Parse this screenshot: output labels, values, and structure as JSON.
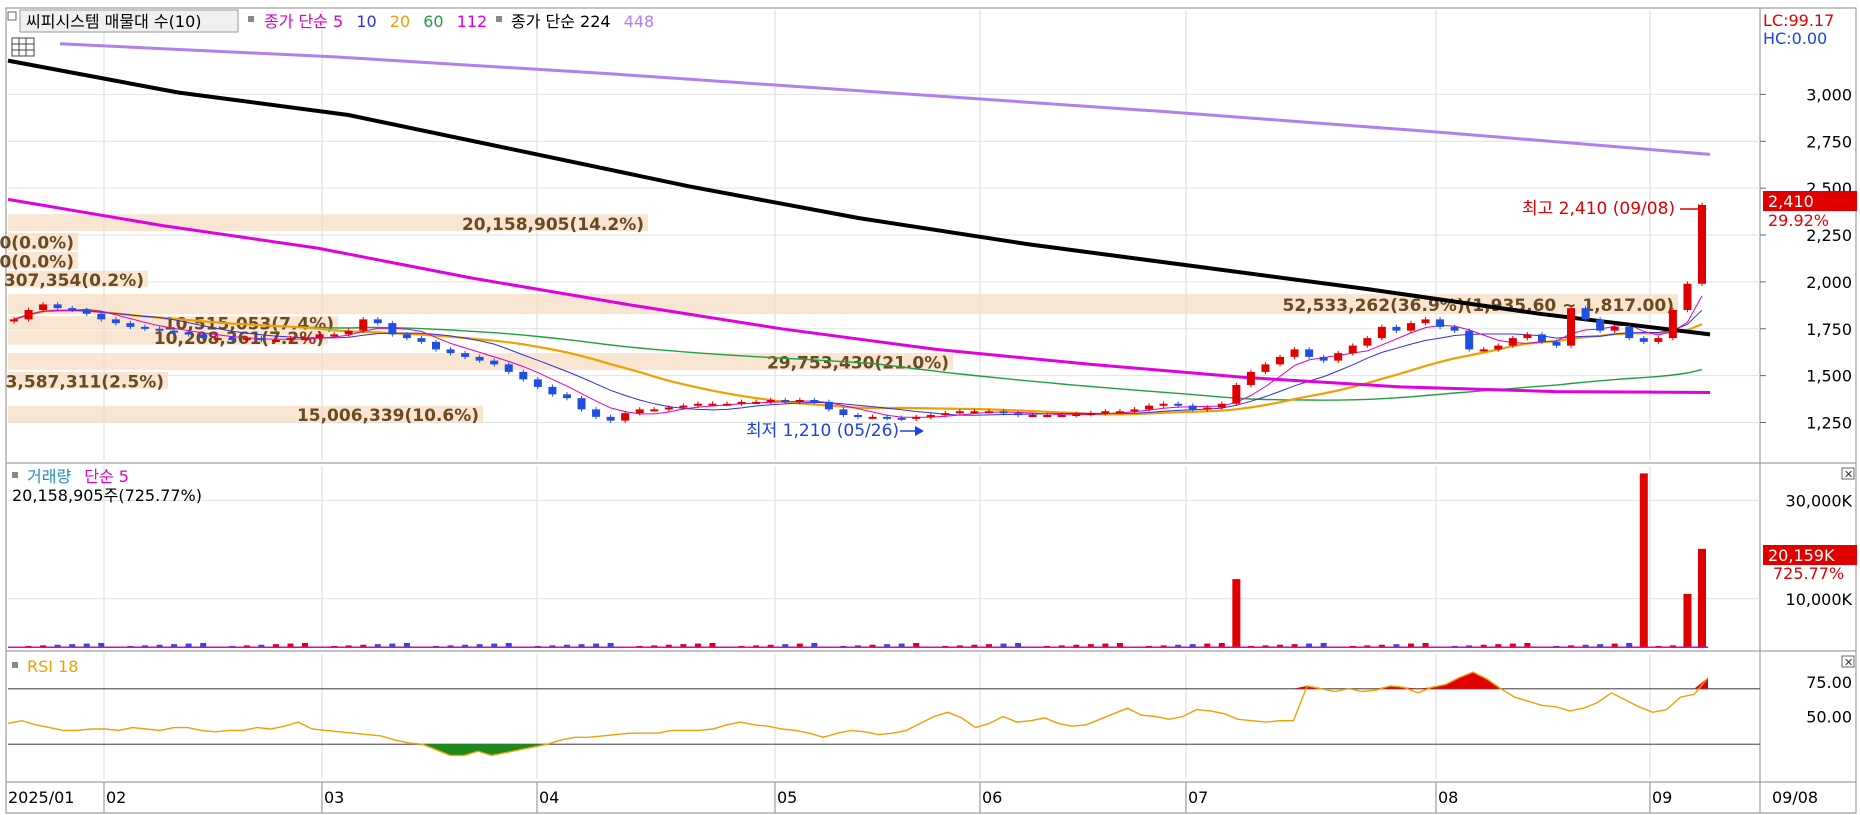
{
  "price_panel": {
    "title": "씨피시스템 매물대 수(10)",
    "legend": [
      {
        "text": "종가 단순 5",
        "color": "#e000c8"
      },
      {
        "text": "10",
        "color": "#3030e0"
      },
      {
        "text": "20",
        "color": "#f0a000"
      },
      {
        "text": "60",
        "color": "#20a040"
      },
      {
        "text": "112",
        "color": "#e000e0"
      },
      {
        "text": "종가 단순 224",
        "color": "#000000"
      },
      {
        "text": "448",
        "color": "#b080f0"
      }
    ],
    "lc_label": "LC:99.17",
    "hc_label": "HC:0.00",
    "last_price": "2,410",
    "last_change": "29.92%",
    "high_annotation": "최고 2,410 (09/08)",
    "low_annotation": "최저 1,210 (05/26)"
  },
  "volume_panel": {
    "title": "거래량",
    "ma_label": "단순 5",
    "summary": "20,158,905주(725.77%)",
    "last_volume": "20,159K",
    "last_change": "725.77%"
  },
  "rsi_panel": {
    "title": "RSI 18"
  },
  "date_axis": {
    "first_label": "2025/01",
    "last_label": "09/08"
  },
  "chart_data": [
    {
      "type": "candlestick",
      "title": "씨피시스템 매물대 수(10)",
      "y_ticks": [
        "3,000",
        "2,750",
        "2,500",
        "2,250",
        "2,000",
        "1,750",
        "1,500",
        "1,250"
      ],
      "ylim": [
        1050,
        3450
      ],
      "x_ticks": [
        "2025/01",
        "02",
        "03",
        "04",
        "05",
        "06",
        "07",
        "08",
        "09"
      ],
      "highest": {
        "value": 2410,
        "date": "09/08"
      },
      "lowest": {
        "value": 1210,
        "date": "05/26"
      },
      "close_approx": [
        1800,
        1850,
        1880,
        1860,
        1850,
        1830,
        1800,
        1780,
        1760,
        1750,
        1740,
        1730,
        1720,
        1700,
        1700,
        1690,
        1700,
        1690,
        1690,
        1700,
        1700,
        1720,
        1720,
        1740,
        1800,
        1780,
        1720,
        1700,
        1680,
        1640,
        1620,
        1600,
        1580,
        1560,
        1520,
        1480,
        1440,
        1400,
        1380,
        1320,
        1280,
        1260,
        1300,
        1320,
        1320,
        1330,
        1340,
        1350,
        1350,
        1350,
        1360,
        1360,
        1370,
        1360,
        1370,
        1360,
        1320,
        1290,
        1280,
        1280,
        1275,
        1270,
        1280,
        1290,
        1300,
        1310,
        1310,
        1310,
        1300,
        1290,
        1290,
        1290,
        1290,
        1295,
        1300,
        1310,
        1310,
        1320,
        1340,
        1350,
        1340,
        1320,
        1330,
        1350,
        1450,
        1520,
        1560,
        1600,
        1640,
        1600,
        1580,
        1620,
        1660,
        1700,
        1760,
        1740,
        1780,
        1800,
        1760,
        1740,
        1640,
        1640,
        1660,
        1700,
        1720,
        1680,
        1660,
        1860,
        1800,
        1740,
        1760,
        1700,
        1680,
        1700,
        1850,
        1990,
        2410
      ],
      "volume_profile": [
        {
          "label": "20,158,905(14.2%)",
          "price_low": 2260,
          "price_high": 2360
        },
        {
          "label": "0(0.0%)",
          "price_low": 2160,
          "price_high": 2260
        },
        {
          "label": "0(0.0%)",
          "price_low": 2060,
          "price_high": 2160
        },
        {
          "label": "307,354(0.2%)",
          "price_low": 1960,
          "price_high": 2060
        },
        {
          "label": "52,533,262(36.9%)(1,935.60 ~ 1,817.00)",
          "price_low": 1817,
          "price_high": 1935
        },
        {
          "label": "10,515,053(7.4%)",
          "price_low": 1740,
          "price_high": 1817
        },
        {
          "label": "10,208,361(7.2%)",
          "price_low": 1660,
          "price_high": 1740
        },
        {
          "label": "29,753,430(21.0%)",
          "price_low": 1520,
          "price_high": 1620
        },
        {
          "label": "3,587,311(2.5%)",
          "price_low": 1420,
          "price_high": 1520
        },
        {
          "label": "15,006,339(10.6%)",
          "price_low": 1240,
          "price_high": 1340
        }
      ],
      "series": [
        {
          "name": "종가 단순 5",
          "color": "#e000c8"
        },
        {
          "name": "10",
          "color": "#3030e0"
        },
        {
          "name": "20",
          "color": "#f0a000"
        },
        {
          "name": "60",
          "color": "#20a040"
        },
        {
          "name": "112",
          "color": "#e000e0",
          "values_approx": [
            2440,
            2300,
            2180,
            2020,
            1880,
            1750,
            1640,
            1560,
            1490,
            1440,
            1415,
            1410
          ]
        },
        {
          "name": "종가 단순 224",
          "color": "#000000",
          "values_approx": [
            3180,
            3010,
            2890,
            2700,
            2510,
            2340,
            2200,
            2080,
            1960,
            1830,
            1720
          ]
        },
        {
          "name": "448",
          "color": "#b080f0",
          "values_approx": [
            3270,
            3200,
            3110,
            3010,
            2910,
            2800,
            2680
          ]
        }
      ]
    },
    {
      "type": "bar",
      "title": "거래량",
      "y_ticks": [
        "30,000K",
        "10,000K"
      ],
      "ylim": [
        0,
        37000
      ],
      "unit": "K",
      "last_value": 20159,
      "spikes_approx": [
        {
          "position": "08 early",
          "value": 14000
        },
        {
          "position": "09 early",
          "value": 35500
        },
        {
          "position": "09/05",
          "value": 11000
        },
        {
          "position": "09/08",
          "value": 20159
        }
      ]
    },
    {
      "type": "line",
      "title": "RSI 18",
      "y_ticks": [
        "75.00",
        "50.00"
      ],
      "ylim": [
        5,
        95
      ],
      "reference_lines": [
        70,
        30
      ],
      "values_approx": [
        45,
        47,
        44,
        42,
        40,
        40,
        41,
        41,
        40,
        42,
        41,
        40,
        42,
        42,
        40,
        39,
        40,
        40,
        42,
        41,
        43,
        46,
        41,
        40,
        39,
        38,
        37,
        36,
        33,
        31,
        30,
        26,
        22,
        22,
        25,
        22,
        24,
        26,
        28,
        30,
        33,
        35,
        35,
        36,
        37,
        38,
        38,
        38,
        40,
        40,
        40,
        41,
        44,
        46,
        44,
        43,
        41,
        40,
        38,
        35,
        38,
        40,
        39,
        37,
        38,
        40,
        45,
        50,
        53,
        49,
        42,
        45,
        50,
        46,
        47,
        49,
        45,
        43,
        44,
        48,
        52,
        56,
        51,
        50,
        48,
        50,
        55,
        54,
        52,
        48,
        47,
        46,
        47,
        47,
        72,
        70,
        68,
        70,
        68,
        69,
        72,
        71,
        67,
        71,
        73,
        78,
        82,
        77,
        70,
        64,
        61,
        58,
        57,
        54,
        56,
        60,
        67,
        62,
        57,
        53,
        55,
        64,
        66,
        78
      ]
    }
  ]
}
